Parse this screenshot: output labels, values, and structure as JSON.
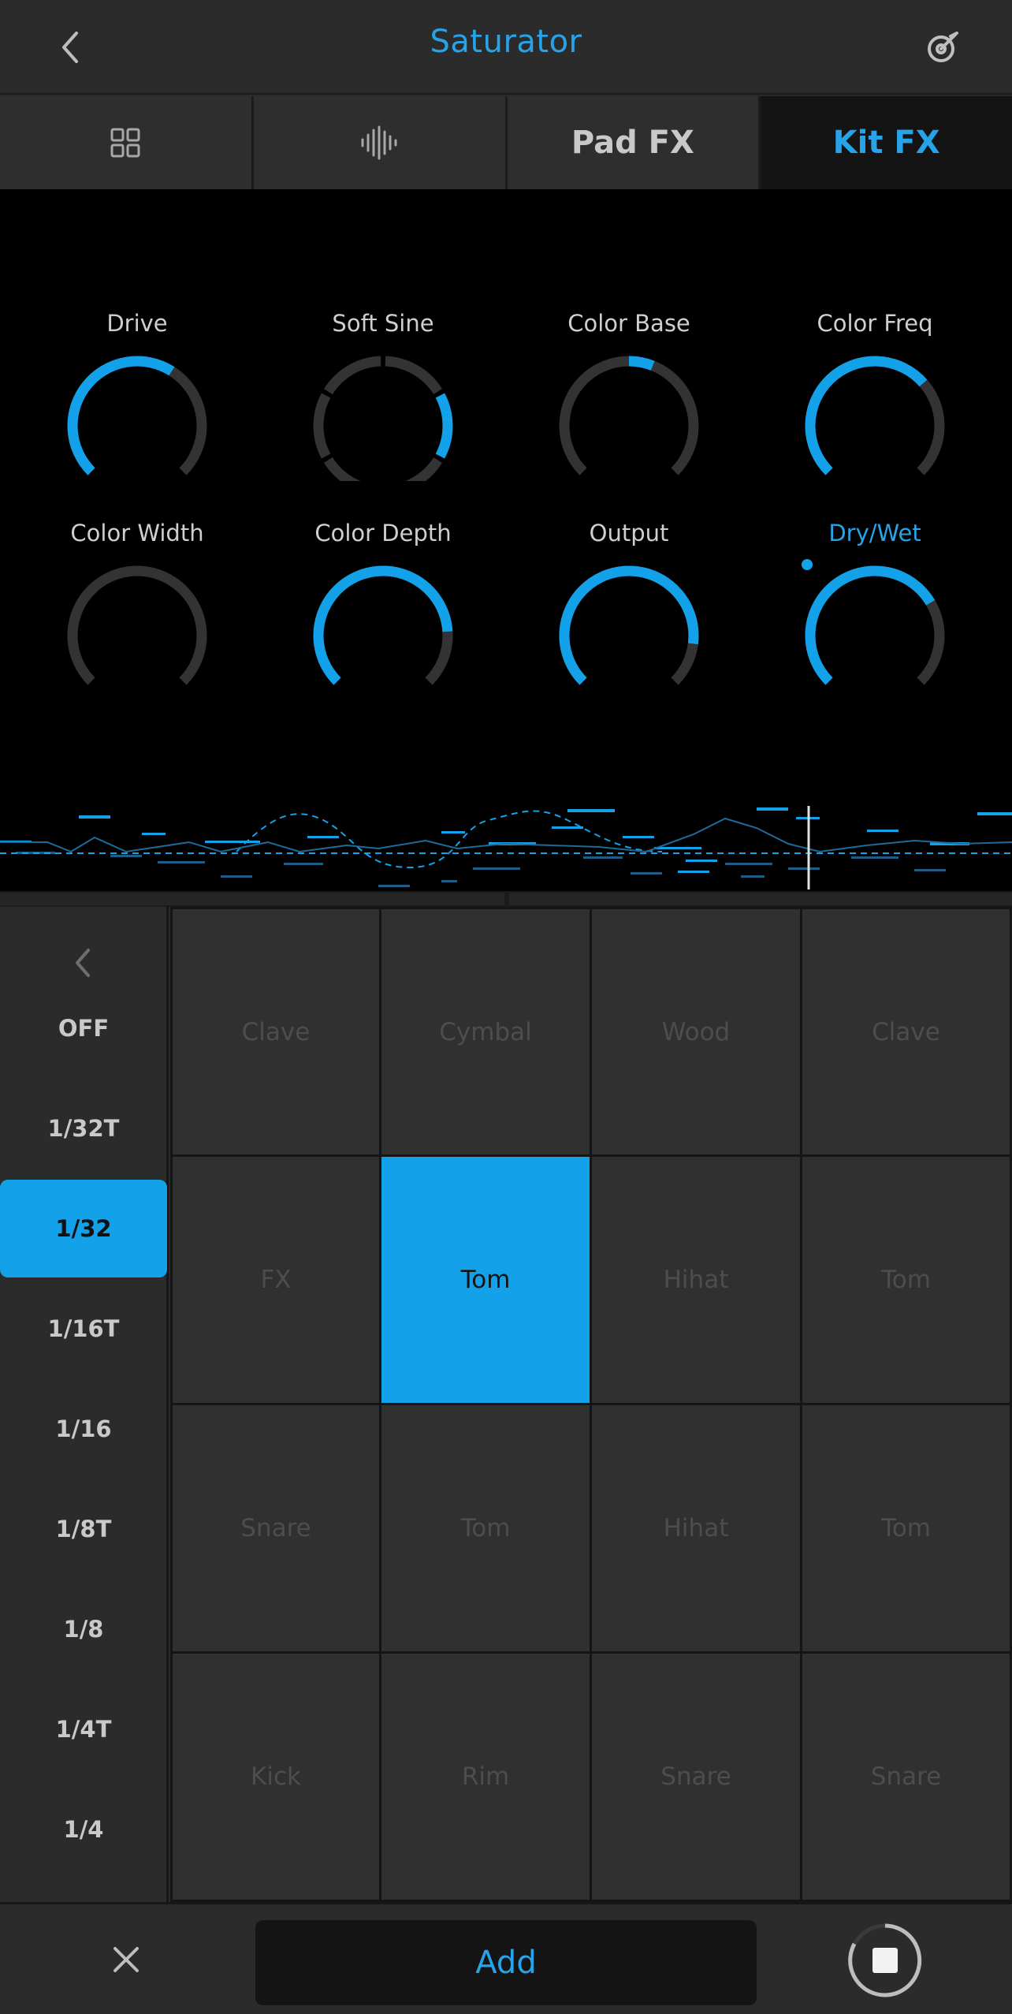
{
  "header": {
    "title": "Saturator",
    "back_icon": "chevron-left-icon",
    "settings_icon": "tuner-icon"
  },
  "tabs": [
    {
      "label": "",
      "icon": "grid-icon",
      "active": false
    },
    {
      "label": "",
      "icon": "waveform-icon",
      "active": false
    },
    {
      "label": "Pad FX",
      "active": false
    },
    {
      "label": "Kit FX",
      "active": true
    }
  ],
  "knobs": [
    {
      "label": "Drive",
      "value": 0.62,
      "active": false
    },
    {
      "label": "Soft Sine",
      "value": 0.5,
      "active": false
    },
    {
      "label": "Color Base",
      "value": 0.58,
      "active": false
    },
    {
      "label": "Color Freq",
      "value": 0.68,
      "active": false
    },
    {
      "label": "Color Width",
      "value": 0.0,
      "active": false
    },
    {
      "label": "Color Depth",
      "value": 0.82,
      "active": false
    },
    {
      "label": "Output",
      "value": 0.86,
      "active": false
    },
    {
      "label": "Dry/Wet",
      "value": 0.72,
      "active": true
    }
  ],
  "colors": {
    "accent": "#13a1ea",
    "text_accent": "#27a3e9",
    "knob_track": "#333333",
    "pad": "#303030",
    "background": "#000000"
  },
  "rates": {
    "back_icon": "chevron-left-icon",
    "items": [
      "OFF",
      "1/32T",
      "1/32",
      "1/16T",
      "1/16",
      "1/8T",
      "1/8",
      "1/4T",
      "1/4"
    ],
    "selected": "1/32"
  },
  "pads": [
    [
      "Clave",
      "Cymbal",
      "Wood",
      "Clave"
    ],
    [
      "FX",
      "Tom",
      "Hihat",
      "Tom"
    ],
    [
      "Snare",
      "Tom",
      "Hihat",
      "Tom"
    ],
    [
      "Kick",
      "Rim",
      "Snare",
      "Snare"
    ]
  ],
  "active_pad": {
    "row": 1,
    "col": 1
  },
  "bottom": {
    "close_icon": "close-icon",
    "add_label": "Add",
    "stop_icon": "stop-icon"
  }
}
